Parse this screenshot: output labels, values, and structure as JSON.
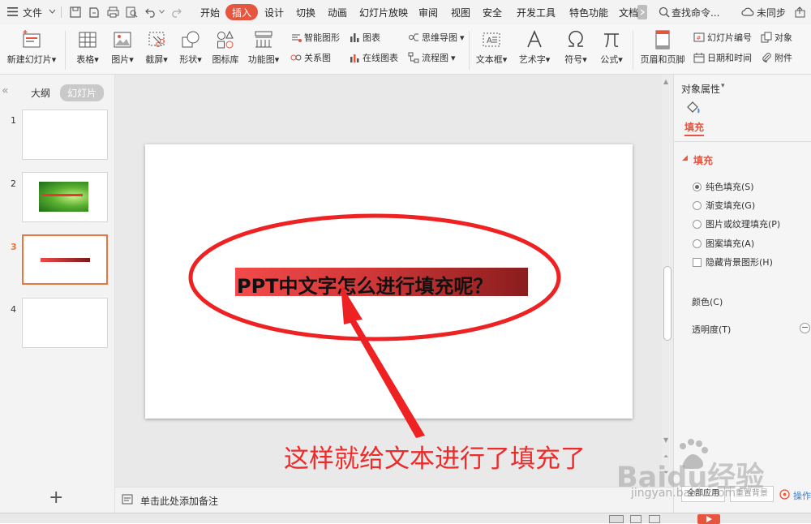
{
  "menu": {
    "file": "文件",
    "tabs": [
      "开始",
      "插入",
      "设计",
      "切换",
      "动画",
      "幻灯片放映",
      "审阅",
      "视图",
      "安全",
      "开发工具",
      "特色功能",
      "文档"
    ],
    "active_tab": "插入",
    "search": "查找命令...",
    "sync": "未同步"
  },
  "ribbon": {
    "new_slide": "新建幻灯片",
    "table": "表格",
    "picture": "图片",
    "screenshot": "截屏",
    "shape": "形状",
    "icon_lib": "图标库",
    "function_chart": "功能图",
    "smart_art": "智能图形",
    "relation": "关系图",
    "chart": "图表",
    "online_chart": "在线图表",
    "mind_map": "思维导图",
    "flowchart": "流程图",
    "textbox": "文本框",
    "wordart": "艺术字",
    "symbol": "符号",
    "formula": "公式",
    "header_footer": "页眉和页脚",
    "slide_number": "幻灯片编号",
    "datetime": "日期和时间",
    "object": "对象",
    "attachment": "附件"
  },
  "left_panel": {
    "outline_tab": "大纲",
    "slides_tab": "幻灯片",
    "thumb_numbers": [
      "1",
      "2",
      "3",
      "4"
    ],
    "selected_index": 3
  },
  "slide": {
    "highlighted_text": "PPT中文字怎么进行填充呢？"
  },
  "annotation": "这样就给文本进行了填充了",
  "notes_placeholder": "单击此处添加备注",
  "right_panel": {
    "title": "对象属性",
    "tab": "填充",
    "section": "填充",
    "options": [
      "纯色填充(S)",
      "渐变填充(G)",
      "图片或纹理填充(P)",
      "图案填充(A)"
    ],
    "checkbox": "隐藏背景图形(H)",
    "color_label": "颜色(C)",
    "transparency_label": "透明度(T)",
    "apply_all": "全部应用",
    "reset_bg": "重置背景",
    "operation": "操作"
  },
  "watermark": {
    "brand": "Baidu经验",
    "url": "jingyan.baidu.com"
  },
  "colors": {
    "accent": "#e8553e",
    "annotation_red": "#ee2b2b",
    "highlight_start": "#f04848",
    "highlight_end": "#8b1e1e"
  }
}
